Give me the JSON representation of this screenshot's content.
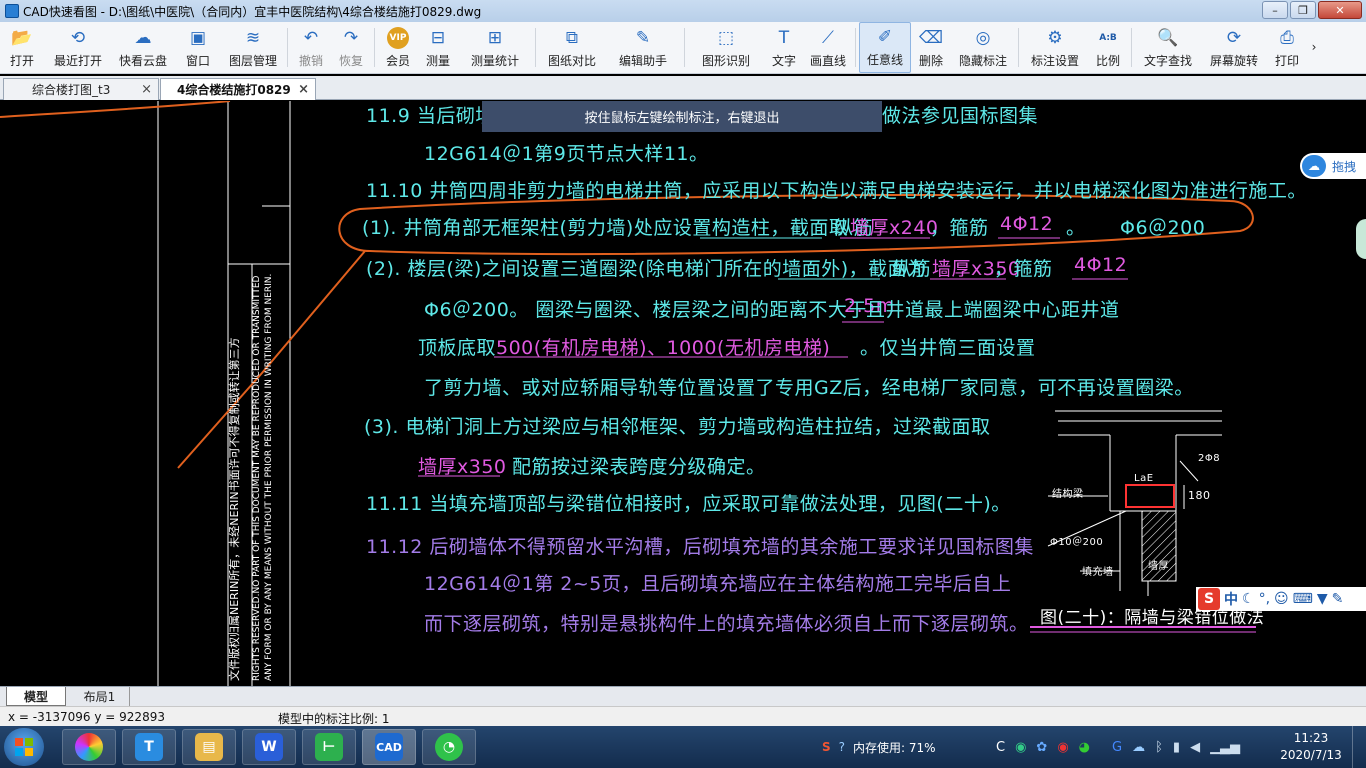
{
  "window": {
    "title": "CAD快速看图 - D:\\图纸\\中医院\\（合同内）宜丰中医院结构\\4综合楼结施打0829.dwg"
  },
  "toolbar": {
    "items": [
      {
        "label": "打开",
        "icon": "folder-open-icon"
      },
      {
        "label": "最近打开",
        "icon": "recent-icon"
      },
      {
        "label": "快看云盘",
        "icon": "cloud-icon"
      },
      {
        "label": "窗口",
        "icon": "window-icon"
      },
      {
        "label": "图层管理",
        "icon": "layers-icon"
      },
      {
        "label": "撤销",
        "icon": "undo-icon"
      },
      {
        "label": "恢复",
        "icon": "redo-icon"
      },
      {
        "label": "会员",
        "icon": "vip-icon",
        "badge": "VIP"
      },
      {
        "label": "测量",
        "icon": "measure-icon"
      },
      {
        "label": "测量统计",
        "icon": "measure-stats-icon"
      },
      {
        "label": "图纸对比",
        "icon": "compare-icon"
      },
      {
        "label": "编辑助手",
        "icon": "edit-assistant-icon"
      },
      {
        "label": "图形识别",
        "icon": "shape-recognize-icon"
      },
      {
        "label": "文字",
        "icon": "text-icon"
      },
      {
        "label": "画直线",
        "icon": "line-icon"
      },
      {
        "label": "任意线",
        "icon": "freehand-icon"
      },
      {
        "label": "删除",
        "icon": "eraser-icon"
      },
      {
        "label": "隐藏标注",
        "icon": "hide-annotation-icon"
      },
      {
        "label": "标注设置",
        "icon": "annotation-settings-icon"
      },
      {
        "label": "比例",
        "icon": "scale-icon",
        "badge": "A:B"
      },
      {
        "label": "文字查找",
        "icon": "text-search-icon"
      },
      {
        "label": "屏幕旋转",
        "icon": "screen-rotate-icon"
      },
      {
        "label": "打印",
        "icon": "print-icon"
      }
    ],
    "more": "›"
  },
  "tabs": [
    {
      "label": "综合楼打图_t3",
      "close": "×"
    },
    {
      "label": "4综合楼结施打0829",
      "close": "×"
    }
  ],
  "hint": "按住鼠标左键绘制标注，右键退出",
  "drawing": {
    "lines": [
      {
        "text": "11.9  当后砌填充墙",
        "cls": "cy"
      },
      {
        "text": "做法参见国标图集",
        "cls": "cy"
      },
      {
        "text": "12G614＠1第9页节点大样11。",
        "cls": "cy"
      },
      {
        "text": "11.10  井筒四周非剪力墙的电梯井筒，应采用以下构造以满足电梯安装运行，并以电梯深化图为准进行施工。",
        "cls": "cy"
      },
      {
        "text": "(1). 井筒角部无框架柱(剪力墙)处应设置构造柱，截面取",
        "cls": "cy"
      },
      {
        "text": "纵筋",
        "cls": "cy"
      },
      {
        "text": "墙厚x240",
        "cls": "mg"
      },
      {
        "text": "，箍筋",
        "cls": "cy"
      },
      {
        "text": "4Φ12",
        "cls": "mg"
      },
      {
        "text": "。",
        "cls": "cy"
      },
      {
        "text": "Φ6＠200",
        "cls": "cy"
      },
      {
        "text": "(2). 楼层(梁)之间设置三道圈梁(除电梯门所在的墙面外)，截面为",
        "cls": "cy"
      },
      {
        "text": "纵筋",
        "cls": "cy"
      },
      {
        "text": "墙厚x350",
        "cls": "mg"
      },
      {
        "text": "，箍筋",
        "cls": "cy"
      },
      {
        "text": "4Φ12",
        "cls": "mg"
      },
      {
        "text": "Φ6＠200。 圈梁与圈梁、楼层梁之间的距离不大于",
        "cls": "cy"
      },
      {
        "text": "2.5m",
        "cls": "mg"
      },
      {
        "text": "且井道最上端圈梁中心距井道",
        "cls": "cy"
      },
      {
        "text": "顶板底取",
        "cls": "cy"
      },
      {
        "text": "500(有机房电梯)、1000(无机房电梯)",
        "cls": "mg"
      },
      {
        "text": "。仅当井筒三面设置",
        "cls": "cy"
      },
      {
        "text": "了剪力墙、或对应轿厢导轨等位置设置了专用GZ后，经电梯厂家同意，可不再设置圈梁。",
        "cls": "cy"
      },
      {
        "text": "(3). 电梯门洞上方过梁应与相邻框架、剪力墙或构造柱拉结，过梁截面取",
        "cls": "cy"
      },
      {
        "text": "墙厚x350",
        "cls": "mg"
      },
      {
        "text": "配筋按过梁表跨度分级确定。",
        "cls": "cy"
      },
      {
        "text": "11.11  当填充墙顶部与梁错位相接时，应采取可靠做法处理，见图(二十)。",
        "cls": "cy"
      },
      {
        "text": "11.12  后砌墙体不得预留水平沟槽，后砌填充墙的其余施工要求详见国标图集",
        "cls": "pp"
      },
      {
        "text": "12G614＠1第  2~5页，且后砌填充墙应在主体结构施工完毕后自上",
        "cls": "pp"
      },
      {
        "text": "而下逐层砌筑，特别是悬挑构件上的填充墙体必须自上而下逐层砌筑。",
        "cls": "pp"
      }
    ],
    "detail": {
      "caption": "图(二十)：隔墙与梁错位做法",
      "labels": [
        "LaE",
        "2Φ8",
        "180",
        "结构梁",
        "Φ10＠200",
        "填充墙",
        "墙厚"
      ]
    },
    "vertical_text": [
      "文件版权归属NERIN所有，未经NERIN书面许可不得复制或转让第三方",
      "RIGHTS RESERVED.NO PART OF THIS DOCUMENT MAY BE REPRODUCED OR TRANSMITTED",
      "ANY FORM OR BY ANY MEANS WITHOUT THE PRIOR PERMISSION IN WRITING FROM NERIN."
    ]
  },
  "side_pill": {
    "label": "拖拽"
  },
  "ime": {
    "logo": "S",
    "lang": "中"
  },
  "layout_tabs": [
    "模型",
    "布局1"
  ],
  "status": {
    "coords": "x = -3137096  y = 922893",
    "scale": "模型中的标注比例: 1"
  },
  "taskbar": {
    "apps": [
      "app-colorball-icon",
      "app-t-icon",
      "file-explorer-icon",
      "wps-icon",
      "app-green-icon",
      "cad-viewer-icon",
      "wechat-icon"
    ],
    "cad_label": "CAD",
    "tray_memory": "内存使用: 71%",
    "tray_c": "C",
    "time": "11:23",
    "date": "2020/7/13",
    "colors": {
      "accent": "#2a7fd4",
      "cad_cyan": "#5ee8e8",
      "cad_magenta": "#e05ae0",
      "annotation": "#e0601e"
    }
  }
}
